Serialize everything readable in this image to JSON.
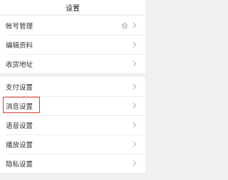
{
  "header": {
    "title": "设置"
  },
  "groups": [
    {
      "items": [
        {
          "label": "帐号管理",
          "icon": "home-icon"
        },
        {
          "label": "编辑资料"
        },
        {
          "label": "收货地址"
        }
      ]
    },
    {
      "items": [
        {
          "label": "支付设置"
        },
        {
          "label": "消息设置",
          "highlighted": true
        },
        {
          "label": "语音设置"
        },
        {
          "label": "播放设置"
        },
        {
          "label": "隐私设置"
        }
      ]
    }
  ],
  "colors": {
    "background": "#f0f0f0",
    "highlight": "#e0392b",
    "chevron": "#b5b5b5"
  }
}
